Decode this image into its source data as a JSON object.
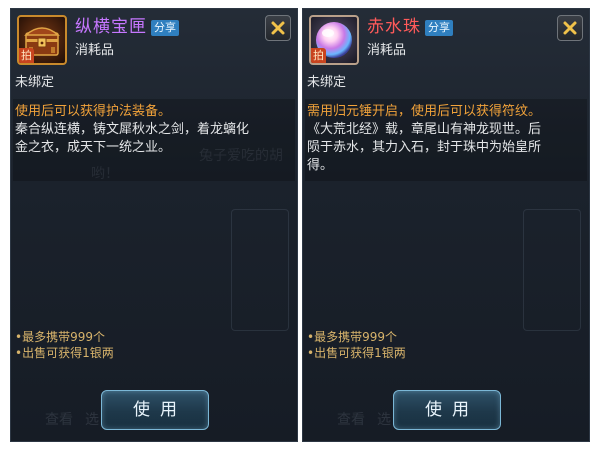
{
  "items": [
    {
      "name": "纵横宝匣",
      "share": "分享",
      "pai": "拍",
      "type": "消耗品",
      "bind": "未绑定",
      "hint": "使用后可以获得护法装备。",
      "desc_lines": [
        "秦合纵连横，铸文犀秋水之剑，着龙螭化",
        "金之衣，成天下一统之业。"
      ],
      "bullets": [
        "•最多携带999个",
        "•出售可获得1银两"
      ],
      "use_label": "使用",
      "icon": "treasure-chest-icon",
      "name_color": "#c677ff"
    },
    {
      "name": "赤水珠",
      "share": "分享",
      "pai": "拍",
      "type": "消耗品",
      "bind": "未绑定",
      "hint": "需用归元锤开启，使用后可以获得符纹。",
      "desc_lines": [
        "《大荒北经》载，章尾山有神龙现世。后",
        "陨于赤水，其力入石，封于珠中为始皇所",
        "得。"
      ],
      "bullets": [
        "•最多携带999个",
        "•出售可获得1银两"
      ],
      "use_label": "使用",
      "icon": "pearl-orb-icon",
      "name_color": "#ff5a5a"
    }
  ],
  "background": {
    "ghost_text": [
      "兔子爱吃的胡",
      "哟！",
      "查看",
      "选"
    ]
  }
}
